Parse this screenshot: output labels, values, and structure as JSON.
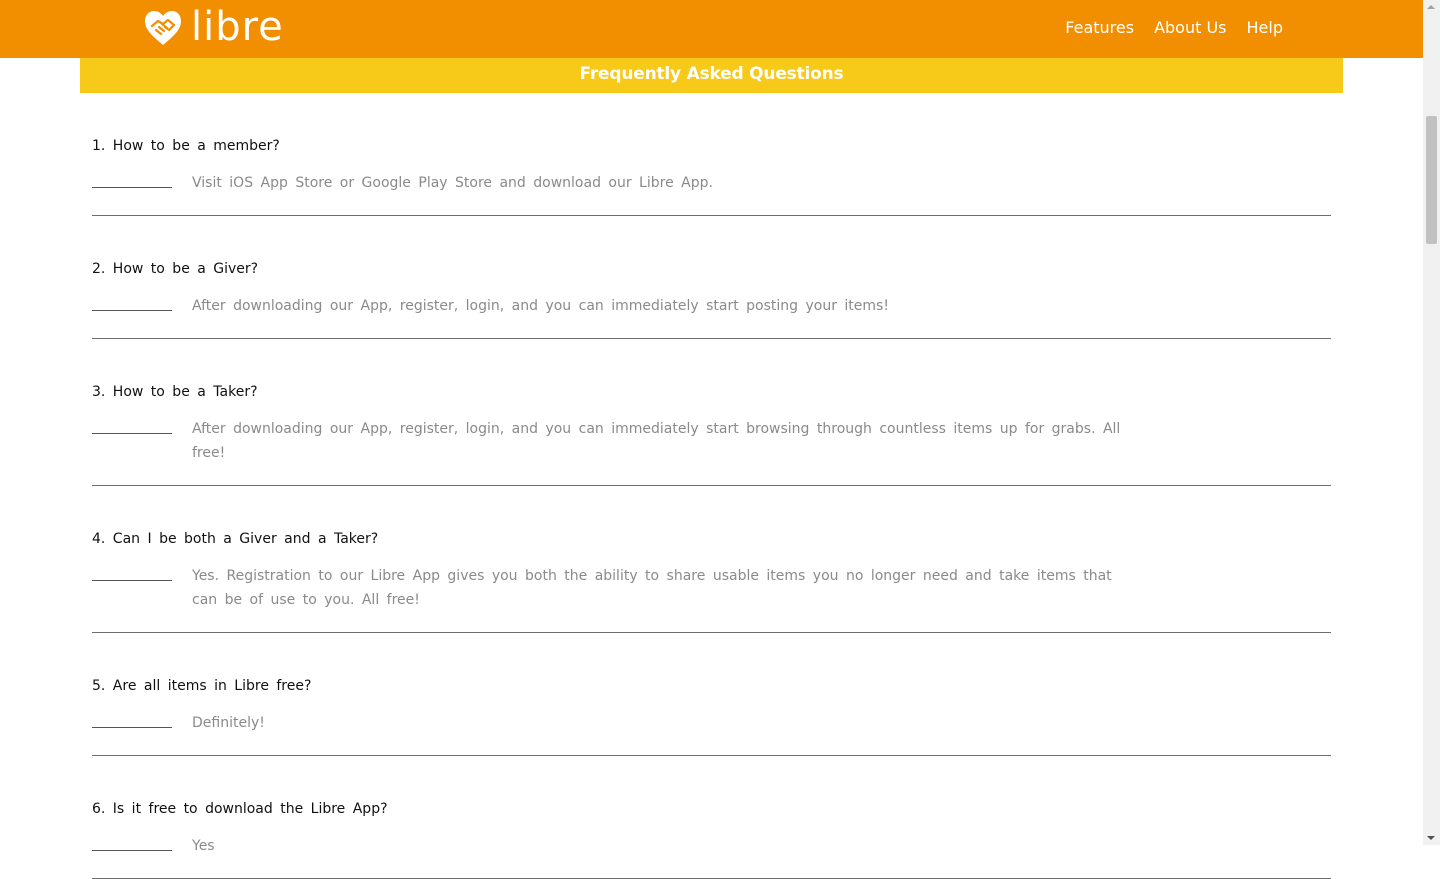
{
  "header": {
    "logo_text": "libre",
    "logo_icon": "heart-handshake-icon",
    "nav": [
      {
        "label": "Features"
      },
      {
        "label": "About Us"
      },
      {
        "label": "Help"
      }
    ]
  },
  "banner": {
    "title": "Frequently Asked Questions"
  },
  "faqs": [
    {
      "question": "1. How to be a member?",
      "answer": "Visit iOS App Store or Google Play Store and download our Libre App."
    },
    {
      "question": "2. How to be a Giver?",
      "answer": "After downloading our App, register, login, and you can immediately start posting your items!"
    },
    {
      "question": "3. How to be a Taker?",
      "answer": "After downloading our App, register, login, and you can immediately start browsing through countless items up for grabs. All free!"
    },
    {
      "question": "4. Can I be both a Giver and a Taker?",
      "answer": "Yes. Registration to our Libre App gives you both the ability to share usable items you no longer need and take items that can be of use to you. All free!"
    },
    {
      "question": "5. Are all items in Libre free?",
      "answer": "Definitely!"
    },
    {
      "question": "6. Is it free to download the Libre App?",
      "answer": "Yes"
    }
  ],
  "colors": {
    "navbar": "#f28f00",
    "banner": "#f7c919",
    "text_dark": "#111111",
    "text_muted": "#8a8a8a"
  }
}
